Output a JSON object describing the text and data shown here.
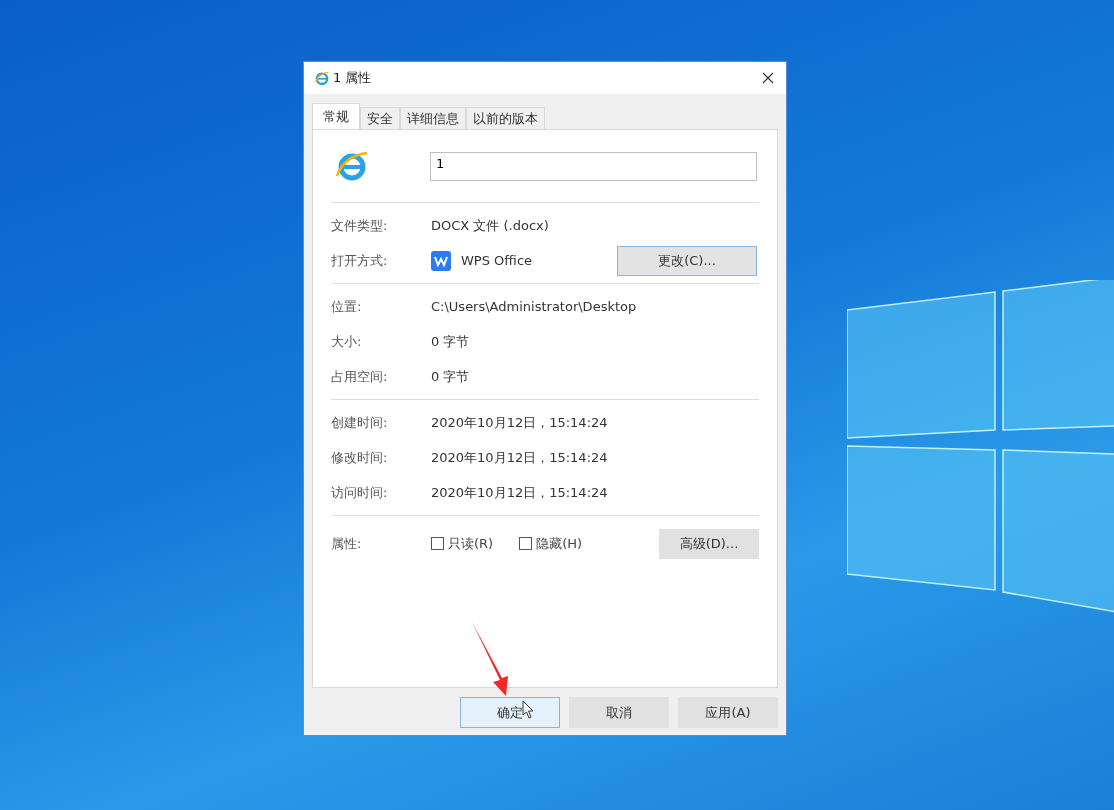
{
  "window": {
    "title": "1 属性"
  },
  "tabs": [
    {
      "label": "常规",
      "selected": true
    },
    {
      "label": "安全",
      "selected": false
    },
    {
      "label": "详细信息",
      "selected": false
    },
    {
      "label": "以前的版本",
      "selected": false
    }
  ],
  "name_field": {
    "value": "1"
  },
  "sections": [
    {
      "rows": [
        {
          "kind": "text",
          "label": "文件类型:",
          "value": "DOCX 文件 (.docx)"
        },
        {
          "kind": "app",
          "label": "打开方式:",
          "value": "WPS Office",
          "button": "更改(C)..."
        }
      ]
    },
    {
      "rows": [
        {
          "kind": "text",
          "label": "位置:",
          "value": "C:\\Users\\Administrator\\Desktop"
        },
        {
          "kind": "text",
          "label": "大小:",
          "value": "0 字节"
        },
        {
          "kind": "text",
          "label": "占用空间:",
          "value": "0 字节"
        }
      ]
    },
    {
      "rows": [
        {
          "kind": "text",
          "label": "创建时间:",
          "value": "2020年10月12日，15:14:24"
        },
        {
          "kind": "text",
          "label": "修改时间:",
          "value": "2020年10月12日，15:14:24"
        },
        {
          "kind": "text",
          "label": "访问时间:",
          "value": "2020年10月12日，15:14:24"
        }
      ]
    }
  ],
  "attributes": {
    "label": "属性:",
    "checkboxes": [
      {
        "label": "只读(R)",
        "checked": false
      },
      {
        "label": "隐藏(H)",
        "checked": false
      }
    ],
    "button": "高级(D)..."
  },
  "buttons": [
    {
      "label": "确定",
      "focused": true
    },
    {
      "label": "取消",
      "focused": false
    },
    {
      "label": "应用(A)",
      "focused": false
    }
  ]
}
